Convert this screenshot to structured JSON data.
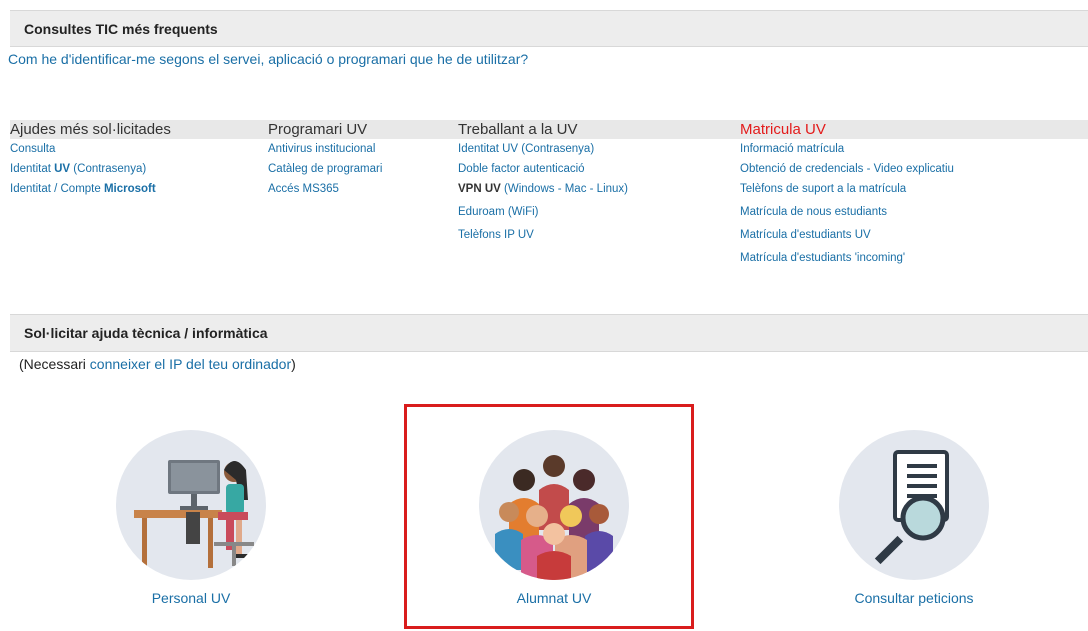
{
  "section1": {
    "title": "Consultes TIC més frequents"
  },
  "identify_link": "Com he d'identificar-me segons el servei, aplicació o programari que he de utilitzar?",
  "columns": [
    {
      "title": "Ajudes més sol·licitades",
      "items": [
        "Consulta",
        "Identitat UV (Contrasenya)",
        "Identitat / Compte Microsoft"
      ]
    },
    {
      "title": "Programari UV",
      "items": [
        "Antivirus institucional",
        "Catàleg de programari",
        "Accés MS365"
      ]
    },
    {
      "title": "Treballant a la UV",
      "items": [
        "Identitat UV (Contrasenya)",
        "Doble factor autenticació",
        "VPN UV (Windows - Mac - Linux)",
        "Eduroam (WiFi)",
        "Telèfons IP UV"
      ]
    },
    {
      "title": "Matricula UV",
      "items": [
        "Informació matrícula",
        "Obtenció de credencials - Video explicatiu",
        "Telèfons de suport a la matrícula",
        "Matrícula de nous estudiants",
        "Matrícula d'estudiants UV",
        "Matrícula d'estudiants 'incoming'"
      ]
    }
  ],
  "section2": {
    "title": "Sol·licitar ajuda tècnica / informàtica"
  },
  "need_note": {
    "prefix": "(Necessari ",
    "link": "conneixer el IP del teu ordinador",
    "suffix": ")"
  },
  "tiles": [
    {
      "label": "Personal UV",
      "icon": "office-worker-icon"
    },
    {
      "label": "Alumnat UV",
      "icon": "students-group-icon"
    },
    {
      "label": "Consultar peticions",
      "icon": "magnifier-document-icon"
    }
  ],
  "colors": {
    "link": "#1a6fa6",
    "accent_red": "#e31b1b",
    "bar_bg": "#ededed",
    "highlight": "#d91c1c"
  }
}
